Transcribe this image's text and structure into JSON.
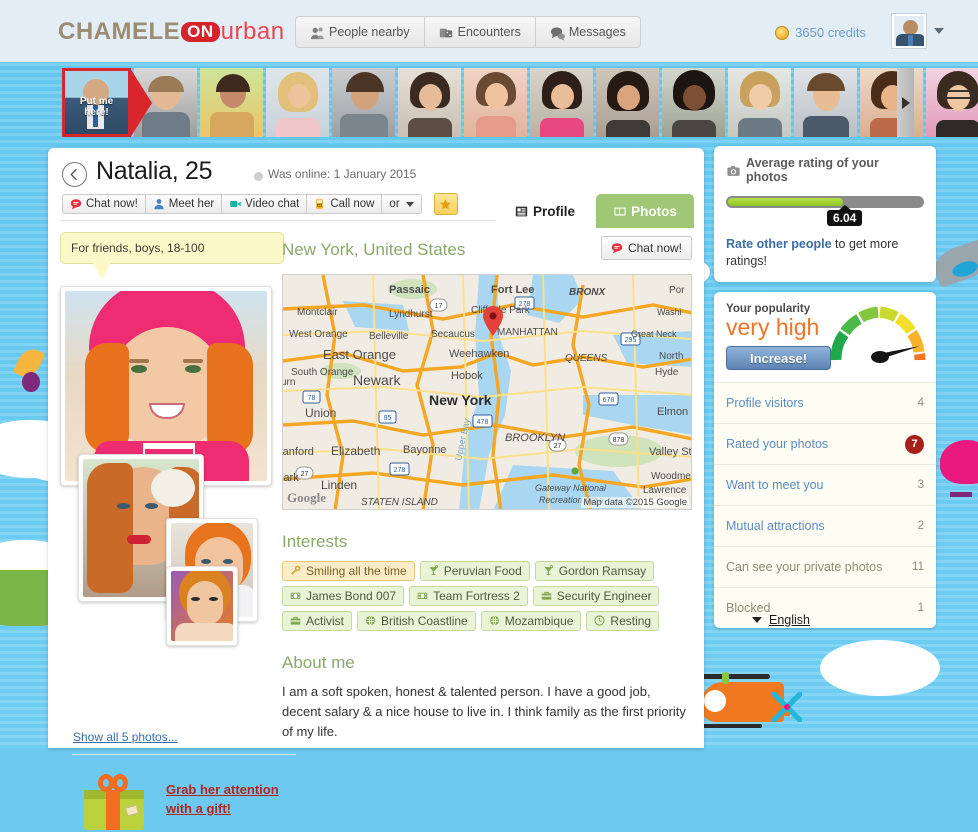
{
  "header": {
    "logo": {
      "part1": "CHAMELE",
      "on": "ON",
      "part2": "urban"
    },
    "nav": [
      {
        "label": "People nearby",
        "icon": "people-icon"
      },
      {
        "label": "Encounters",
        "icon": "dice-icon"
      },
      {
        "label": "Messages",
        "icon": "chat-bubble-icon"
      }
    ],
    "credits": "3650 credits",
    "credits_icon": "coin-icon",
    "avatar_icon": "user-avatar"
  },
  "thumbstrip": {
    "put_me_here": "Put me\nhere!",
    "put_me_line1": "Put me",
    "put_me_line2": "here!",
    "next_label": "▶"
  },
  "profile": {
    "back_label": "←",
    "name": "Natalia, 25",
    "was_online": "Was online: 1 January 2015",
    "actions": [
      {
        "label": "Chat now!",
        "icon": "chat-bubble-icon"
      },
      {
        "label": "Meet her",
        "icon": "person-icon"
      },
      {
        "label": "Video chat",
        "icon": "video-camera-icon"
      },
      {
        "label": "Call now",
        "icon": "phone-icon"
      },
      {
        "label": "or",
        "icon": "chevron-down-icon"
      }
    ],
    "favourite_icon": "star-icon"
  },
  "tabs": [
    {
      "label": "Profile",
      "icon": "document-icon",
      "active": true
    },
    {
      "label": "Photos",
      "icon": "photos-icon",
      "active": false
    }
  ],
  "left": {
    "tooltip": "For friends, boys, 18-100",
    "show_all": "Show all 5 photos...",
    "gift_line1": "Grab her attention",
    "gift_line2": "with a gift!",
    "gift_icon": "gift-box-icon"
  },
  "main": {
    "location": "New York, United States",
    "chat_now": "Chat now!",
    "map": {
      "attribution": "Map data ©2015 Google",
      "watermark": "Google",
      "marker": "map-pin-icon",
      "labels": [
        "Passaic",
        "Fort Lee",
        "BRONX",
        "Por",
        "Montclair",
        "Lyndhurst",
        "Cliffside Park",
        "West Orange",
        "Belleville",
        "Secaucus",
        "MANHATTAN",
        "Great Neck",
        "Washi",
        "East Orange",
        "Weehawken",
        "QUEENS",
        "North",
        "South Orange",
        "Hoboken",
        "Newark",
        "New York",
        "Hyde",
        "urn",
        "Union",
        "Elmon",
        "BROOKLYN",
        "Upper Bay",
        "ranford",
        "Elizabeth",
        "Bayonne",
        "Valley Str",
        "lark",
        "Linden",
        "Woodme",
        "Lawrence",
        "STATEN ISLAND",
        "Gateway National",
        "Recreation Area"
      ],
      "shields": [
        "17",
        "278",
        "295",
        "78",
        "95",
        "478",
        "678",
        "878",
        "27",
        "27",
        "278"
      ]
    },
    "interests_title": "Interests",
    "interests": [
      {
        "label": "Smiling all the time",
        "icon": "wrench-icon",
        "style": "yellow"
      },
      {
        "label": "Peruvian Food",
        "icon": "cocktail-icon",
        "style": "green"
      },
      {
        "label": "Gordon Ramsay",
        "icon": "cocktail-icon",
        "style": "green"
      },
      {
        "label": "James Bond 007",
        "icon": "film-icon",
        "style": "green"
      },
      {
        "label": "Team Fortress 2",
        "icon": "film-icon",
        "style": "green"
      },
      {
        "label": "Security Engineer",
        "icon": "briefcase-icon",
        "style": "green"
      },
      {
        "label": "Activist",
        "icon": "briefcase-icon",
        "style": "green"
      },
      {
        "label": "British Coastline",
        "icon": "globe-icon",
        "style": "green"
      },
      {
        "label": "Mozambique",
        "icon": "globe-icon",
        "style": "green"
      },
      {
        "label": "Resting",
        "icon": "clock-icon",
        "style": "green"
      }
    ],
    "about_title": "About me",
    "about_text": "I am a soft spoken, honest & talented person. I have a good job, decent salary & a nice house to live in. I think family as the first priority of my life."
  },
  "sidebar": {
    "rating": {
      "title": "Average rating of your photos",
      "icon": "camera-icon",
      "value": "6.04",
      "percent": 60,
      "cta_link": "Rate other people",
      "cta_rest": " to get more ratings!"
    },
    "popularity": {
      "label": "Your popularity",
      "value": "very high",
      "button": "Increase!",
      "gauge_icon": "gauge-icon"
    },
    "stats": [
      {
        "label": "Profile visitors",
        "value": "4",
        "badge": false,
        "muted": false
      },
      {
        "label": "Rated your photos",
        "value": "7",
        "badge": true,
        "muted": false
      },
      {
        "label": "Want to meet you",
        "value": "3",
        "badge": false,
        "muted": false
      },
      {
        "label": "Mutual attractions",
        "value": "2",
        "badge": false,
        "muted": false
      },
      {
        "label": "Can see your private photos",
        "value": "11",
        "badge": false,
        "muted": true
      },
      {
        "label": "Blocked",
        "value": "1",
        "badge": false,
        "muted": true
      }
    ]
  },
  "footer": {
    "language": "English",
    "caret_icon": "chevron-down-icon"
  },
  "colors": {
    "sky": "#62c6ef",
    "brand_red": "#d7232c",
    "green_tab": "#9fc776",
    "orange": "#ef7423",
    "link_blue": "#5b8cc4"
  }
}
